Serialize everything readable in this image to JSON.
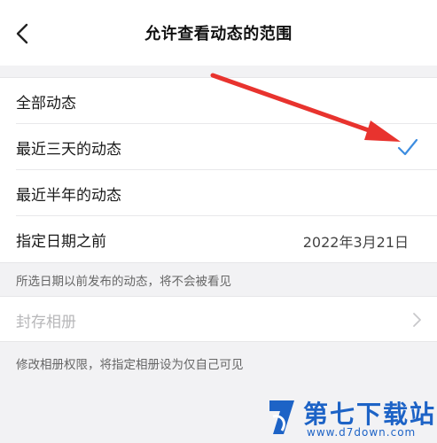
{
  "header": {
    "title": "允许查看动态的范围",
    "back_icon": "chevron-left-icon"
  },
  "options": [
    {
      "label": "全部动态",
      "selected": false
    },
    {
      "label": "最近三天的动态",
      "selected": true
    },
    {
      "label": "最近半年的动态",
      "selected": false
    },
    {
      "label": "指定日期之前",
      "value": "2022年3月21日",
      "selected": false
    }
  ],
  "notes": {
    "date_note": "所选日期以前发布的动态，将不会被看见",
    "album_note": "修改相册权限，将指定相册设为仅自己可见"
  },
  "album": {
    "label": "封存相册",
    "enabled": false
  },
  "watermark": {
    "name": "第七下载站",
    "url": "www.d7down.com"
  },
  "colors": {
    "accent": "#3d8de0",
    "annotation_arrow": "#e8332e",
    "watermark": "#1d63c6"
  }
}
